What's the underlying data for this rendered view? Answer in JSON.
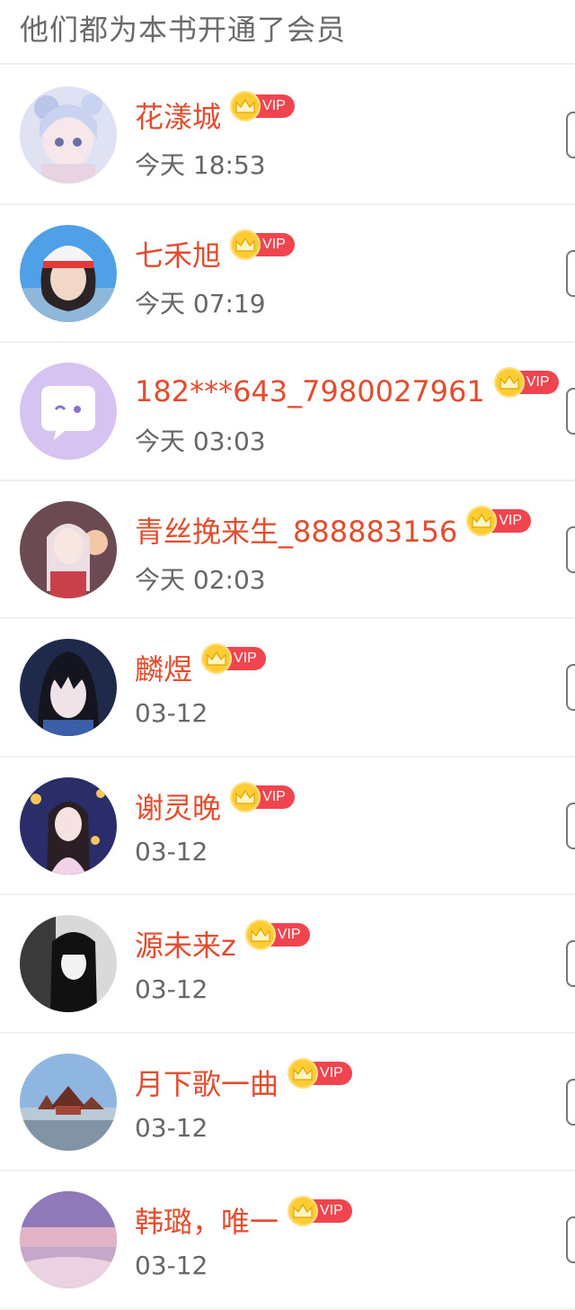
{
  "header": {
    "title": "他们都为本书开通了会员"
  },
  "vip_label": "VIP",
  "colors": {
    "name": "#e44c2e",
    "vip": "#f0454f",
    "crown": "#ffcc33"
  },
  "members": [
    {
      "name": "花漾城",
      "time": "今天 18:53",
      "avatar": "anime-girl-blue-flowers"
    },
    {
      "name": "七禾旭",
      "time": "今天 07:19",
      "avatar": "girl-white-cap"
    },
    {
      "name": "182***643_7980027961",
      "time": "今天 03:03",
      "avatar": "default-chat-bubble"
    },
    {
      "name": "青丝挽来生_888883156",
      "time": "今天 02:03",
      "avatar": "anime-girl-white-hair"
    },
    {
      "name": "麟煜",
      "time": "03-12",
      "avatar": "anime-boy-dark-hair"
    },
    {
      "name": "谢灵晚",
      "time": "03-12",
      "avatar": "anime-girl-lanterns"
    },
    {
      "name": "源未来z",
      "time": "03-12",
      "avatar": "anime-girl-black-hair"
    },
    {
      "name": "月下歌一曲",
      "time": "03-12",
      "avatar": "palace-landscape"
    },
    {
      "name": "韩璐，唯一",
      "time": "03-12",
      "avatar": "pink-sea-sunset"
    }
  ]
}
